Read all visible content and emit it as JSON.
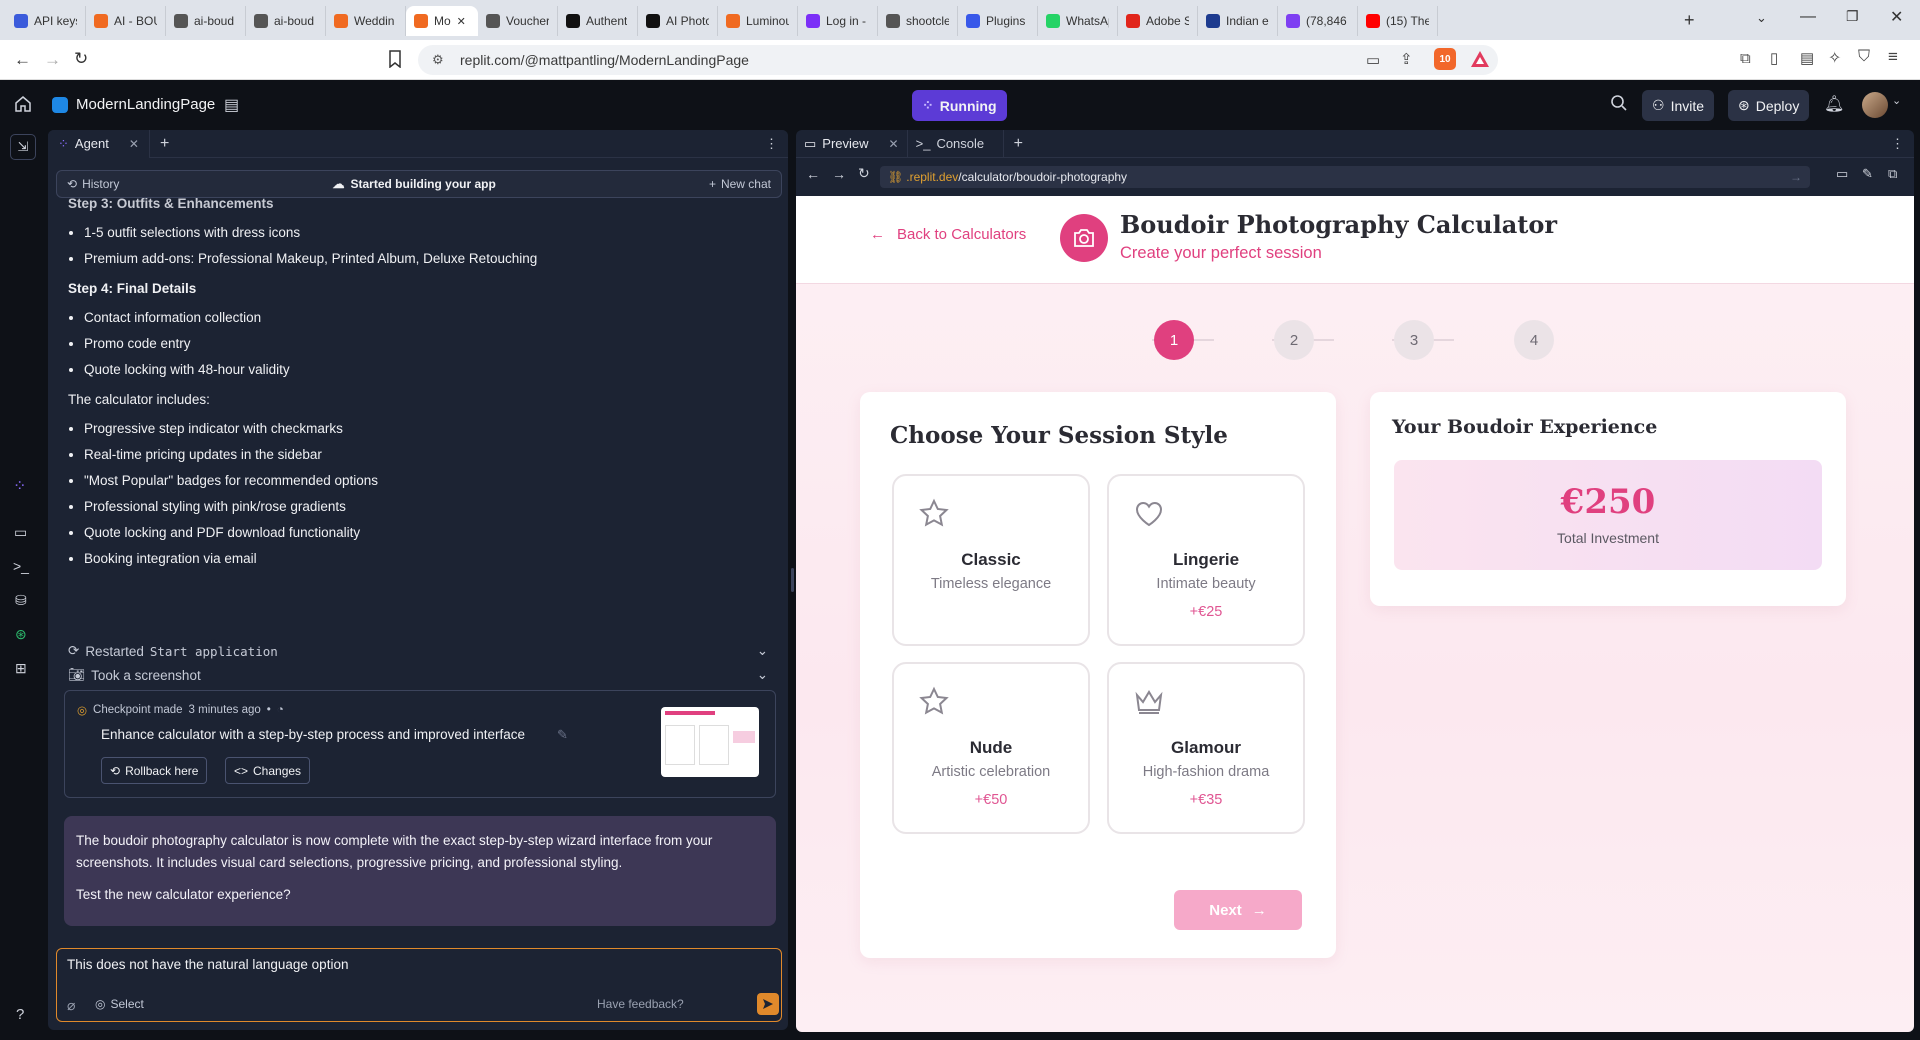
{
  "browser": {
    "tabs": [
      {
        "label": "API keys",
        "color": "#3b5bdb",
        "icon": "globe-icon"
      },
      {
        "label": "AI - BOU",
        "color": "#f06a21",
        "icon": "replit-icon"
      },
      {
        "label": "ai-boud",
        "color": "#555",
        "icon": "globe-icon"
      },
      {
        "label": "ai-boud",
        "color": "#555",
        "icon": "globe-icon"
      },
      {
        "label": "Weddin",
        "color": "#f06a21",
        "icon": "replit-icon"
      },
      {
        "label": "Mo",
        "color": "#f06a21",
        "icon": "replit-icon",
        "active": true
      },
      {
        "label": "Voucher",
        "color": "#555",
        "icon": "globe-icon"
      },
      {
        "label": "Authent",
        "color": "#111",
        "icon": "app-icon"
      },
      {
        "label": "AI Photo",
        "color": "#111",
        "icon": "openai-icon"
      },
      {
        "label": "Luminou",
        "color": "#f06a21",
        "icon": "replit-icon"
      },
      {
        "label": "Log in -",
        "color": "#7b2ff7",
        "icon": "app-icon"
      },
      {
        "label": "shootcle",
        "color": "#555",
        "icon": "globe-icon"
      },
      {
        "label": "Plugins",
        "color": "#3858e9",
        "icon": "wordpress-icon"
      },
      {
        "label": "WhatsAp",
        "color": "#25d366",
        "icon": "whatsapp-icon"
      },
      {
        "label": "Adobe S",
        "color": "#e1251b",
        "icon": "adobe-icon"
      },
      {
        "label": "Indian e",
        "color": "#1d3b8f",
        "icon": "app-icon"
      },
      {
        "label": "(78,846",
        "color": "#7e3ff2",
        "icon": "mail-icon"
      },
      {
        "label": "(15) The",
        "color": "#ff0000",
        "icon": "youtube-icon"
      }
    ],
    "url": "replit.com/@mattpantling/ModernLandingPage",
    "shield_count": "10"
  },
  "replit": {
    "project_name": "ModernLandingPage",
    "run_status": "Running",
    "invite_label": "Invite",
    "deploy_label": "Deploy"
  },
  "agent": {
    "tab_label": "Agent",
    "history_label": "History",
    "status_label": "Started building your app",
    "new_chat_label": "New chat",
    "step3_heading": "Step 3: Outfits & Enhancements",
    "step3_items": [
      "1-5 outfit selections with dress icons",
      "Premium add-ons: Professional Makeup, Printed Album, Deluxe Retouching"
    ],
    "step4_heading": "Step 4: Final Details",
    "step4_items": [
      "Contact information collection",
      "Promo code entry",
      "Quote locking with 48-hour validity"
    ],
    "includes_intro": "The calculator includes:",
    "includes_items": [
      "Progressive step indicator with checkmarks",
      "Real-time pricing updates in the sidebar",
      "\"Most Popular\" badges for recommended options",
      "Professional styling with pink/rose gradients",
      "Quote locking and PDF download functionality",
      "Booking integration via email"
    ],
    "restarted_prefix": "Restarted",
    "restarted_code": "Start application",
    "screenshot_label": "Took a screenshot",
    "checkpoint": {
      "made_label": "Checkpoint made",
      "time": "3 minutes ago",
      "title": "Enhance calculator with a step-by-step process and improved interface",
      "rollback_label": "Rollback here",
      "changes_label": "Changes"
    },
    "reply_text_1": "The boudoir photography calculator is now complete with the exact step-by-step wizard interface from your screenshots. It includes visual card selections, progressive pricing, and professional styling.",
    "reply_text_2": "Test the new calculator experience?",
    "composer_value": "This does not have the natural language option",
    "select_label": "Select",
    "feedback_label": "Have feedback?"
  },
  "preview": {
    "preview_tab": "Preview",
    "console_tab": "Console",
    "url_host": ".replit.dev",
    "url_path": "/calculator/boudoir-photography",
    "site": {
      "back_label": "Back to Calculators",
      "title": "Boudoir Photography Calculator",
      "subtitle": "Create your perfect session",
      "steps": [
        "1",
        "2",
        "3",
        "4"
      ],
      "active_step": "1",
      "section_title": "Choose Your Session Style",
      "options": [
        {
          "title": "Classic",
          "subtitle": "Timeless elegance",
          "price": "",
          "icon": "star-icon"
        },
        {
          "title": "Lingerie",
          "subtitle": "Intimate beauty",
          "price": "+€25",
          "icon": "heart-icon"
        },
        {
          "title": "Nude",
          "subtitle": "Artistic celebration",
          "price": "+€50",
          "icon": "star-icon"
        },
        {
          "title": "Glamour",
          "subtitle": "High-fashion drama",
          "price": "+€35",
          "icon": "crown-icon"
        }
      ],
      "next_label": "Next",
      "sidebar_title": "Your Boudoir Experience",
      "total_price": "€250",
      "total_label": "Total Investment",
      "accent": "#e0407f"
    }
  }
}
